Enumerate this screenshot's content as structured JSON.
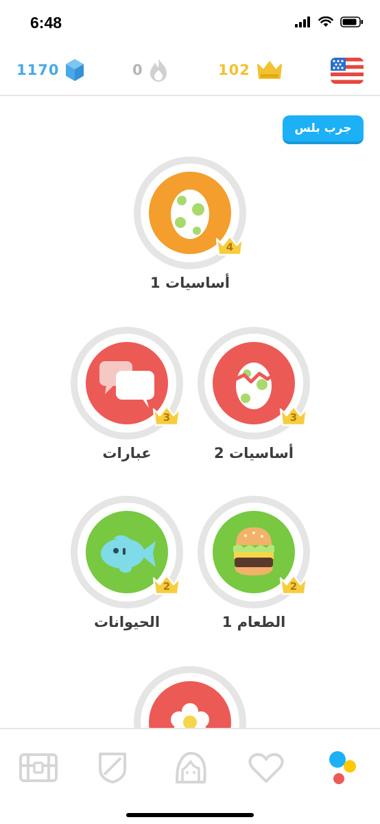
{
  "status_bar": {
    "time": "6:48"
  },
  "stats": {
    "gems": "1170",
    "streak": "0",
    "crowns": "102"
  },
  "plus_button": {
    "label": "جرب بلس"
  },
  "skills": [
    {
      "name": "أساسيات 1",
      "crown_level": "4",
      "color": "#f49e2d"
    },
    {
      "name": "أساسيات 2",
      "crown_level": "3",
      "color": "#ec5a56"
    },
    {
      "name": "عبارات",
      "crown_level": "3",
      "color": "#ec5a56"
    },
    {
      "name": "الطعام 1",
      "crown_level": "2",
      "color": "#78c841"
    },
    {
      "name": "الحيوانات",
      "crown_level": "2",
      "color": "#78c841"
    },
    {
      "name": "",
      "crown_level": "",
      "color": "#ec5a56"
    }
  ],
  "tabs": [
    "learn-tab",
    "leagues-tab",
    "profile-tab",
    "health-tab",
    "labs-tab"
  ],
  "colors": {
    "gem_blue": "#4aa8e8",
    "crown_gold": "#f2c230",
    "plus_blue": "#1cb0f6",
    "ring_gray": "#e5e5e5"
  }
}
